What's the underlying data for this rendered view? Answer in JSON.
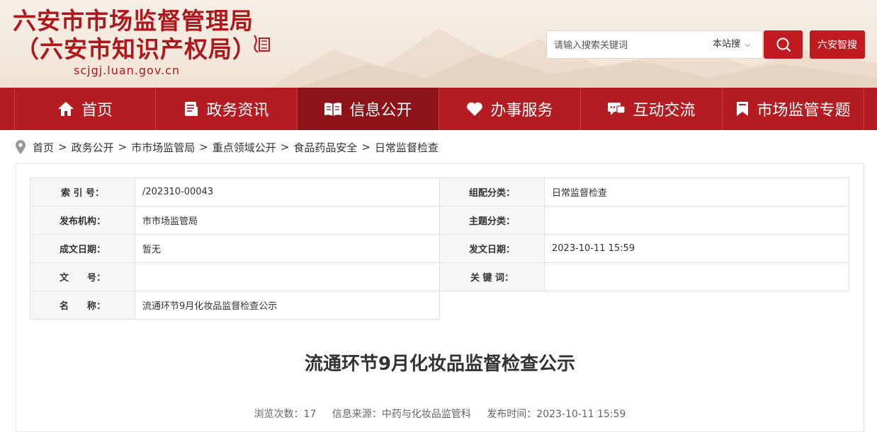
{
  "header": {
    "title_line1": "六安市市场监督管理局",
    "title_line2": "（六安市知识产权局）",
    "domain": "scjgj.luan.gov.cn",
    "search": {
      "placeholder": "请输入搜索关键词",
      "scope": "本站搜",
      "button_icon": "search-icon"
    },
    "smart_button": "六安智搜"
  },
  "nav": [
    {
      "label": "首页",
      "icon": "home-icon"
    },
    {
      "label": "政务资讯",
      "icon": "document-icon"
    },
    {
      "label": "信息公开",
      "icon": "open-book-icon"
    },
    {
      "label": "办事服务",
      "icon": "heart-icon"
    },
    {
      "label": "互动交流",
      "icon": "chat-icon"
    },
    {
      "label": "市场监管专题",
      "icon": "bookmark-icon"
    }
  ],
  "active_nav": "信息公开",
  "breadcrumb": [
    "首页",
    "政务公开",
    "市市场监管局",
    "重点领域公开",
    "食品药品安全",
    "日常监督检查"
  ],
  "meta": {
    "index_label": "索 引 号：",
    "index_value": "/202310-00043",
    "category_label": "组配分类：",
    "category_value": "日常监督检查",
    "publisher_label": "发布机构：",
    "publisher_value": "市市场监管局",
    "topic_label": "主题分类：",
    "topic_value": "",
    "created_label": "成文日期：",
    "created_value": "暂无",
    "issued_label": "发文日期：",
    "issued_value": "2023-10-11 15:59",
    "docno_label": "文　　号：",
    "docno_value": "",
    "keywords_label": "关 键 词：",
    "keywords_value": "",
    "name_label": "名　　称：",
    "name_value": "流通环节9月化妆品监督检查公示"
  },
  "article": {
    "title": "流通环节9月化妆品监督检查公示",
    "views": "浏览次数：17",
    "source": "信息来源：中药与化妆品监管科",
    "published": "发布时间：2023-10-11 15:59"
  },
  "colors": {
    "brand_red": "#b51c22",
    "active_nav": "#8d1318",
    "title_red": "#b0171d"
  }
}
